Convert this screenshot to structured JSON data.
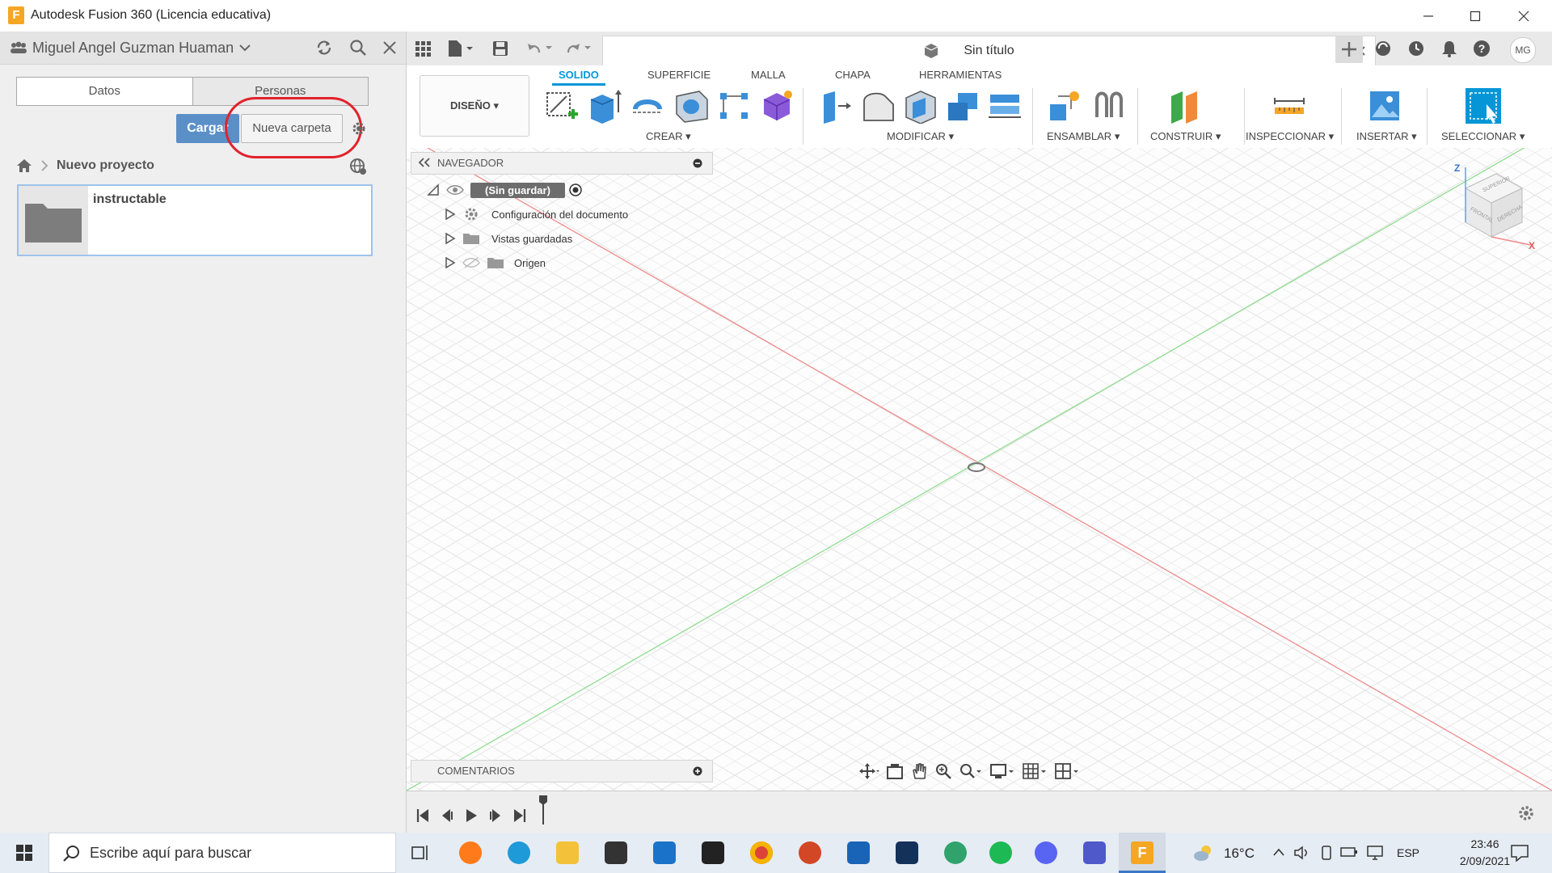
{
  "window": {
    "title": "Autodesk Fusion 360 (Licencia educativa)"
  },
  "left_panel": {
    "user": "Miguel Angel Guzman Huaman",
    "tabs": [
      "Datos",
      "Personas"
    ],
    "upload_label": "Cargar",
    "new_folder_label": "Nueva carpeta",
    "breadcrumb": "Nuevo proyecto",
    "folder_name": "instructable"
  },
  "document": {
    "tab_title": "Sin título"
  },
  "user_initials": "MG",
  "ribbon": {
    "workspace": "DISEÑO",
    "tabs": [
      "SOLIDO",
      "SUPERFICIE",
      "MALLA",
      "CHAPA",
      "HERRAMIENTAS"
    ],
    "groups": [
      "CREAR",
      "MODIFICAR",
      "ENSAMBLAR",
      "CONSTRUIR",
      "INSPECCIONAR",
      "INSERTAR",
      "SELECCIONAR"
    ]
  },
  "browser": {
    "title": "NAVEGADOR",
    "root": "(Sin guardar)",
    "items": [
      "Configuración del documento",
      "Vistas guardadas",
      "Origen"
    ]
  },
  "comments": {
    "title": "COMENTARIOS"
  },
  "viewcube": {
    "axis_z": "Z",
    "axis_x": "X",
    "faces": [
      "SUPERIOR",
      "FRONTAL",
      "DERECHA"
    ]
  },
  "taskbar": {
    "search_placeholder": "Escribe aquí para buscar",
    "temperature": "16°C",
    "language": "ESP",
    "time": "23:46",
    "date": "2/09/2021"
  },
  "colors": {
    "accent": "#0696d7",
    "x_axis": "#f08a8a",
    "y_axis": "#8fdc8f",
    "annotation": "#e2222c"
  }
}
